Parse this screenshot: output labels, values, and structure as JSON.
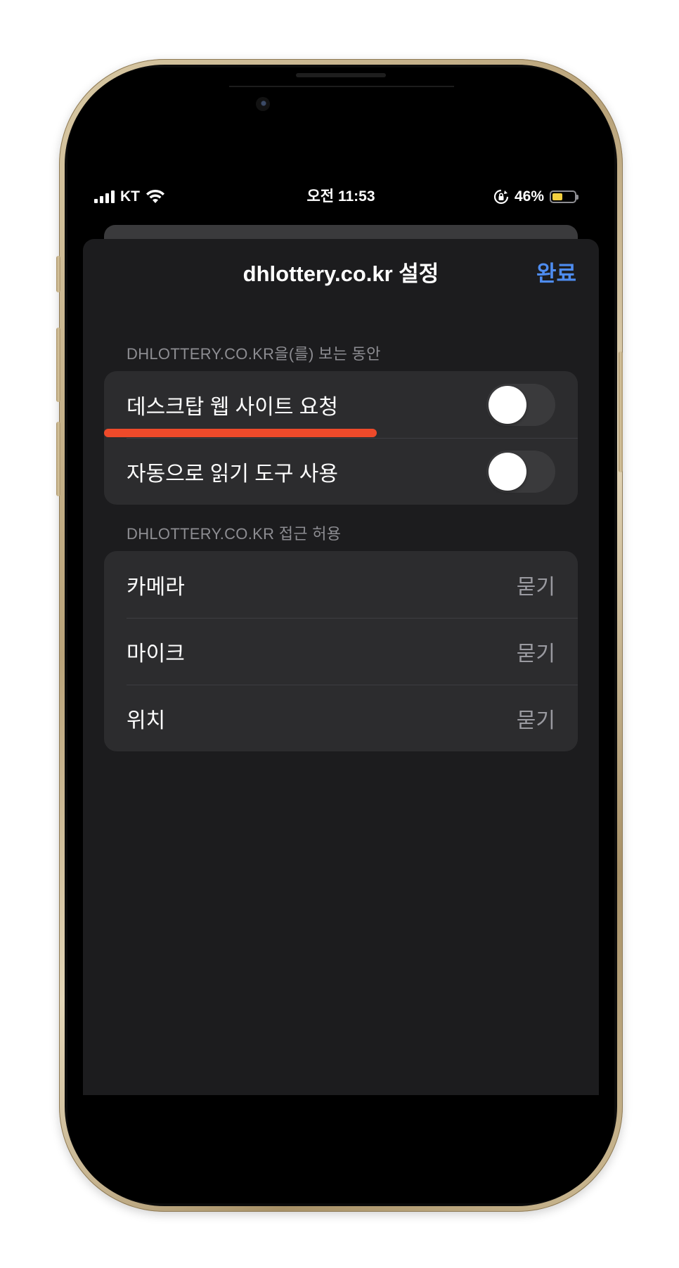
{
  "status_bar": {
    "carrier": "KT",
    "time": "오전 11:53",
    "battery_percent": "46%",
    "battery_level": 0.46,
    "icons": [
      "signal-icon",
      "wifi-icon",
      "rotation-lock-icon",
      "battery-icon"
    ]
  },
  "sheet": {
    "title": "dhlottery.co.kr 설정",
    "done_label": "완료"
  },
  "viewing_section": {
    "header": "DHLOTTERY.CO.KR을(를) 보는 동안",
    "items": [
      {
        "label": "데스크탑 웹 사이트 요청",
        "toggle_on": false
      },
      {
        "label": "자동으로 읽기 도구 사용",
        "toggle_on": false
      }
    ]
  },
  "permissions_section": {
    "header": "DHLOTTERY.CO.KR 접근 허용",
    "items": [
      {
        "label": "카메라",
        "value": "묻기"
      },
      {
        "label": "마이크",
        "value": "묻기"
      },
      {
        "label": "위치",
        "value": "묻기"
      }
    ]
  },
  "colors": {
    "accent": "#4e8cf0",
    "highlight": "#ee4a2a",
    "sheet_bg": "#1c1c1e",
    "row_bg": "#2c2c2e"
  }
}
